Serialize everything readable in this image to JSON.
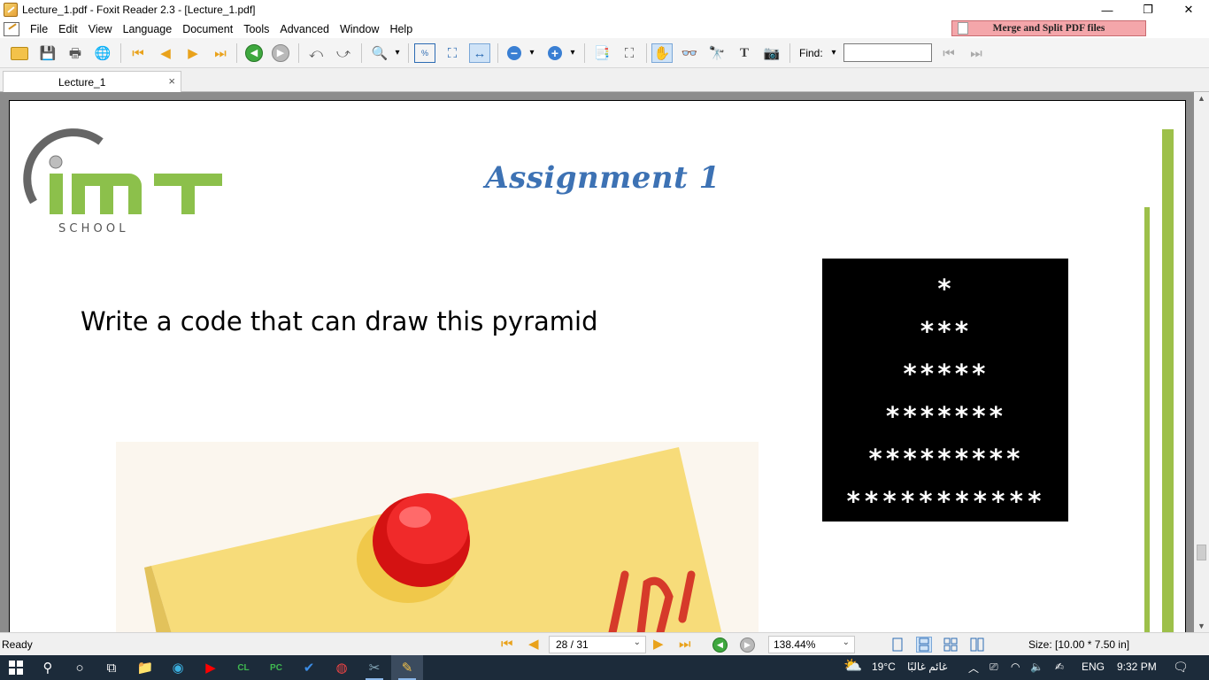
{
  "window": {
    "title": "Lecture_1.pdf - Foxit Reader 2.3 - [Lecture_1.pdf]",
    "minimize": "—",
    "restore": "❐",
    "close": "✕"
  },
  "menubar": {
    "items": [
      "File",
      "Edit",
      "View",
      "Language",
      "Document",
      "Tools",
      "Advanced",
      "Window",
      "Help"
    ],
    "merge_banner": "Merge and Split PDF files"
  },
  "toolbar": {
    "find_label": "Find:",
    "find_value": "",
    "zoom_dropdown": "▾",
    "find_dropdown": "▾"
  },
  "tabs": [
    {
      "label": "Lecture_1",
      "close": "×"
    }
  ],
  "document": {
    "logo_text": "iMT",
    "logo_subtitle": "S C H O O L",
    "title": "Assignment 1",
    "prompt": "Write a code that can draw this pyramid",
    "pyramid_rows": [
      "*",
      "***",
      "*****",
      "*******",
      "*********",
      "***********"
    ]
  },
  "statusbar": {
    "ready": "Ready",
    "page": "28 / 31",
    "zoom": "138.44%",
    "size": "Size: [10.00 * 7.50 in]"
  },
  "taskbar": {
    "weather_temp": "19°C",
    "weather_desc": "غائم غالبًا",
    "language": "ENG",
    "time": "9:32 PM"
  },
  "colors": {
    "accent_blue": "#3d72b4",
    "logo_green": "#8cc04b",
    "taskbar_bg": "#1c2b3a"
  }
}
